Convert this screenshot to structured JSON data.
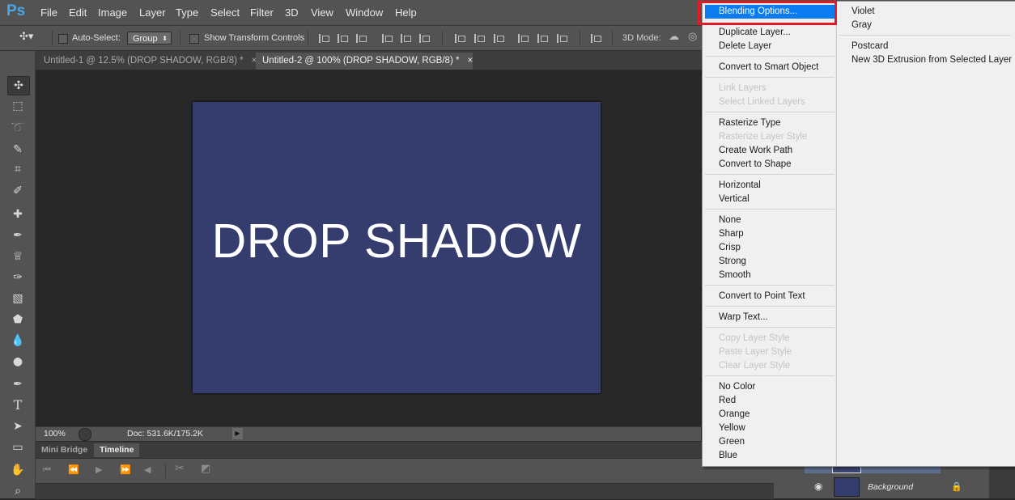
{
  "app": {
    "logo": "Ps"
  },
  "menubar": [
    "File",
    "Edit",
    "Image",
    "Layer",
    "Type",
    "Select",
    "Filter",
    "3D",
    "View",
    "Window",
    "Help"
  ],
  "options": {
    "auto_select_label": "Auto-Select:",
    "group_value": "Group",
    "show_transform_label": "Show Transform Controls",
    "three_d_mode_label": "3D Mode:"
  },
  "tabs": [
    {
      "label": "Untitled-1 @ 12.5% (DROP SHADOW, RGB/8) *",
      "close": "×",
      "active": false
    },
    {
      "label": "Untitled-2 @ 100% (DROP SHADOW, RGB/8) *",
      "close": "×",
      "active": true
    }
  ],
  "canvas": {
    "text": "DROP SHADOW",
    "bg_color": "#353d6e"
  },
  "status": {
    "zoom": "100%",
    "doc_size": "Doc: 531.6K/175.2K"
  },
  "bottom_panel": {
    "tabs": [
      "Mini Bridge",
      "Timeline"
    ],
    "active_tab": "Timeline"
  },
  "layers": {
    "background_label": "Background"
  },
  "context_menu": {
    "items": [
      {
        "label": "Blending Options...",
        "state": "highlighted"
      },
      {
        "label": "Duplicate Layer...",
        "state": "normal"
      },
      {
        "label": "Delete Layer",
        "state": "normal"
      },
      {
        "label": "Convert to Smart Object",
        "state": "normal"
      },
      {
        "label": "Link Layers",
        "state": "disabled"
      },
      {
        "label": "Select Linked Layers",
        "state": "disabled"
      },
      {
        "label": "Rasterize Type",
        "state": "normal"
      },
      {
        "label": "Rasterize Layer Style",
        "state": "disabled"
      },
      {
        "label": "Create Work Path",
        "state": "normal"
      },
      {
        "label": "Convert to Shape",
        "state": "normal"
      },
      {
        "label": "Horizontal",
        "state": "normal"
      },
      {
        "label": "Vertical",
        "state": "normal"
      },
      {
        "label": "None",
        "state": "normal"
      },
      {
        "label": "Sharp",
        "state": "normal"
      },
      {
        "label": "Crisp",
        "state": "normal"
      },
      {
        "label": "Strong",
        "state": "normal"
      },
      {
        "label": "Smooth",
        "state": "normal"
      },
      {
        "label": "Convert to Point Text",
        "state": "normal"
      },
      {
        "label": "Warp Text...",
        "state": "normal"
      },
      {
        "label": "Copy Layer Style",
        "state": "disabled"
      },
      {
        "label": "Paste Layer Style",
        "state": "disabled"
      },
      {
        "label": "Clear Layer Style",
        "state": "disabled"
      },
      {
        "label": "No Color",
        "state": "normal"
      },
      {
        "label": "Red",
        "state": "normal"
      },
      {
        "label": "Orange",
        "state": "normal"
      },
      {
        "label": "Yellow",
        "state": "normal"
      },
      {
        "label": "Green",
        "state": "normal"
      },
      {
        "label": "Blue",
        "state": "normal"
      }
    ],
    "sub_items": [
      "Violet",
      "Gray",
      "Postcard",
      "New 3D Extrusion from Selected Layer"
    ]
  },
  "colors": {
    "highlight": "#0a7bf0",
    "callout": "#e21b24",
    "ps_blue": "#4aa7e8"
  }
}
